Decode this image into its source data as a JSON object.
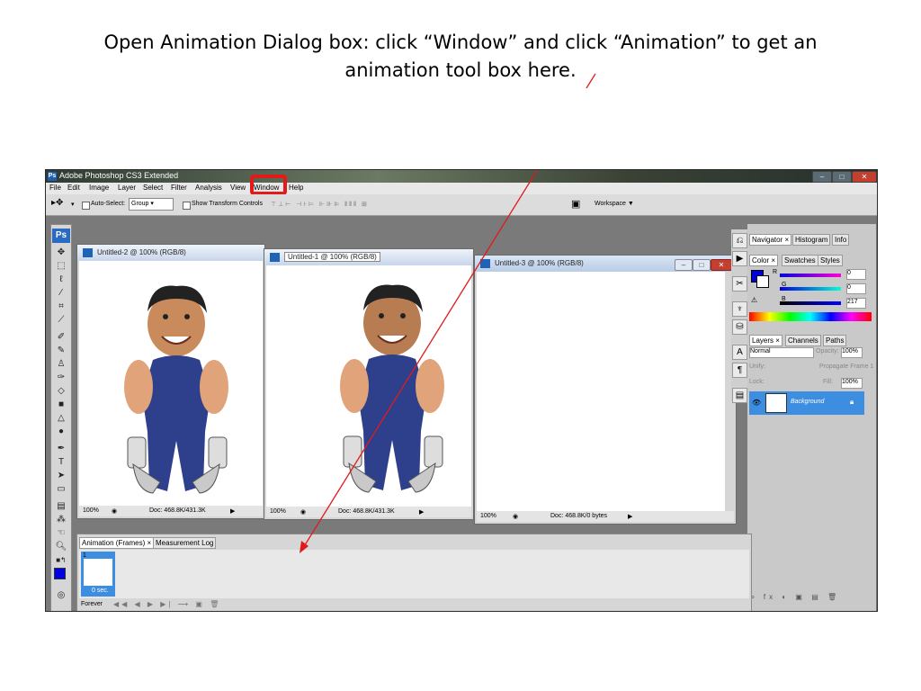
{
  "slide": {
    "title_line1": "Open Animation Dialog box: click “Window” and click “Animation” to get an",
    "title_line2": "animation tool box here."
  },
  "app": {
    "title": "Adobe Photoshop CS3 Extended",
    "icon_label": "Ps",
    "logo": "Ps"
  },
  "menu": [
    "File",
    "Edit",
    "Image",
    "Layer",
    "Select",
    "Filter",
    "Analysis",
    "View",
    "Window",
    "Help"
  ],
  "options_bar": {
    "auto_select_label": "Auto-Select:",
    "auto_select_value": "Group",
    "show_transform": "Show Transform Controls",
    "workspace": "Workspace ▼"
  },
  "documents": [
    {
      "title": "Untitled-2 @ 100% (RGB/8)",
      "zoom": "100%",
      "doc_info": "Doc: 468.8K/431.3K"
    },
    {
      "title": "Untitled-1 @ 100% (RGB/8)",
      "zoom": "100%",
      "doc_info": "Doc: 468.8K/431.3K"
    },
    {
      "title": "Untitled-3 @ 100% (RGB/8)",
      "zoom": "100%",
      "doc_info": "Doc: 468.8K/0 bytes"
    }
  ],
  "panels": {
    "navigator_tabs": [
      "Navigator ×",
      "Histogram",
      "Info"
    ],
    "color_tabs": [
      "Color ×",
      "Swatches",
      "Styles"
    ],
    "color": {
      "r_label": "R",
      "g_label": "G",
      "b_label": "B",
      "r": "0",
      "g": "0",
      "b": "217",
      "fg": "#0000d9"
    },
    "layers_tabs": [
      "Layers ×",
      "Channels",
      "Paths"
    ],
    "blend_mode": "Normal",
    "opacity_label": "Opacity:",
    "opacity": "100%",
    "unify_label": "Unify:",
    "propagate_label": "Propagate Frame 1",
    "lock_label": "Lock:",
    "fill_label": "Fill:",
    "fill": "100%",
    "layer_name": "Background"
  },
  "animation": {
    "tabs": [
      "Animation (Frames) ×",
      "Measurement Log"
    ],
    "frame_number": "1",
    "frame_delay": "0 sec.",
    "loop": "Forever"
  },
  "colors": {
    "accent_red": "#e21a1a",
    "selection_blue": "#3d8ee0"
  }
}
